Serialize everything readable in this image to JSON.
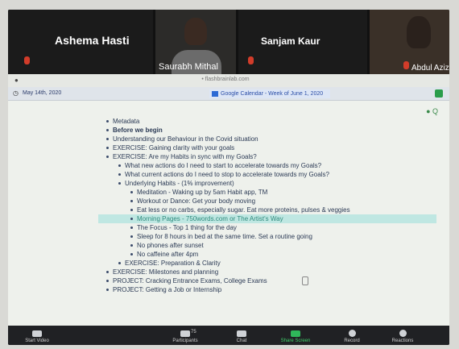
{
  "participants": [
    {
      "name": "Ashema Hasti"
    },
    {
      "name": "Saurabh Mithal"
    },
    {
      "name": "Sanjam Kaur"
    },
    {
      "name": "Abdul Aziz"
    }
  ],
  "browser": {
    "url": "• flashbrainlab.com",
    "date": "May 14th, 2020",
    "gcal_tab": "Google Calendar - Week of June 1, 2020"
  },
  "outline": [
    {
      "text": "Metadata",
      "level": 1
    },
    {
      "text": "Before we begin",
      "level": 1
    },
    {
      "text": "Understanding our Behaviour in the Covid situation",
      "level": 1
    },
    {
      "text": "EXERCISE: Gaining clarity with your goals",
      "level": 1
    },
    {
      "text": "EXERCISE: Are my Habits in sync with my Goals?",
      "level": 1
    },
    {
      "text": "What new actions do I need to start to accelerate towards my Goals?",
      "level": 2
    },
    {
      "text": "What current actions do I need to stop to accelerate towards my Goals?",
      "level": 2
    },
    {
      "text": "Underlying Habits - (1% improvement)",
      "level": 2
    },
    {
      "text": "Meditation - Waking up by 5am Habit app, TM",
      "level": 3
    },
    {
      "text": "Workout or Dance: Get your body moving",
      "level": 3
    },
    {
      "text": "Eat less or no carbs, especially sugar. Eat more proteins, pulses & veggies",
      "level": 3
    },
    {
      "text": "Morning Pages - 750words.com or The Artist's Way",
      "level": 3,
      "highlight": true
    },
    {
      "text": "The Focus - Top 1 thing for the day",
      "level": 3
    },
    {
      "text": "Sleep for 8 hours in bed at the same time. Set a routine going",
      "level": 3
    },
    {
      "text": "No phones after sunset",
      "level": 3
    },
    {
      "text": "No caffeine after 4pm",
      "level": 3
    },
    {
      "text": "EXERCISE: Preparation & Clarity",
      "level": 2
    },
    {
      "text": "EXERCISE: Milestones and planning",
      "level": 1
    },
    {
      "text": "PROJECT: Cracking Entrance Exams, College Exams",
      "level": 1
    },
    {
      "text": "PROJECT: Getting a Job or Internship",
      "level": 1
    }
  ],
  "toolbar": {
    "start_video": "Start Video",
    "participants_count": "75",
    "participants": "Participants",
    "chat": "Chat",
    "share": "Share Screen",
    "record": "Record",
    "reactions": "Reactions"
  }
}
